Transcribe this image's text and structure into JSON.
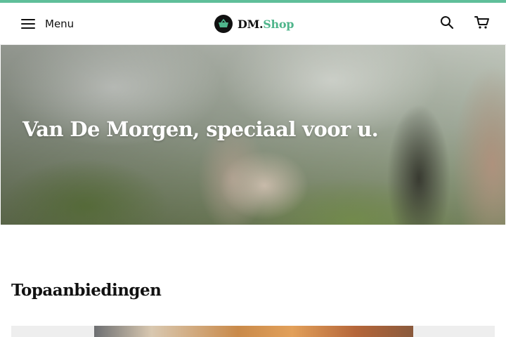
{
  "header": {
    "menu_label": "Menu",
    "logo": {
      "part1": "DM.",
      "part2": "Shop"
    },
    "icons": [
      "menu-icon",
      "basket-icon",
      "search-icon",
      "cart-icon"
    ]
  },
  "hero": {
    "title": "Van De Morgen, speciaal voor u."
  },
  "sections": {
    "top_offers_title": "Topaanbiedingen"
  },
  "colors": {
    "accent_green": "#5fbf9a",
    "logo_shop": "#4fb58b",
    "text_dark": "#111111"
  }
}
